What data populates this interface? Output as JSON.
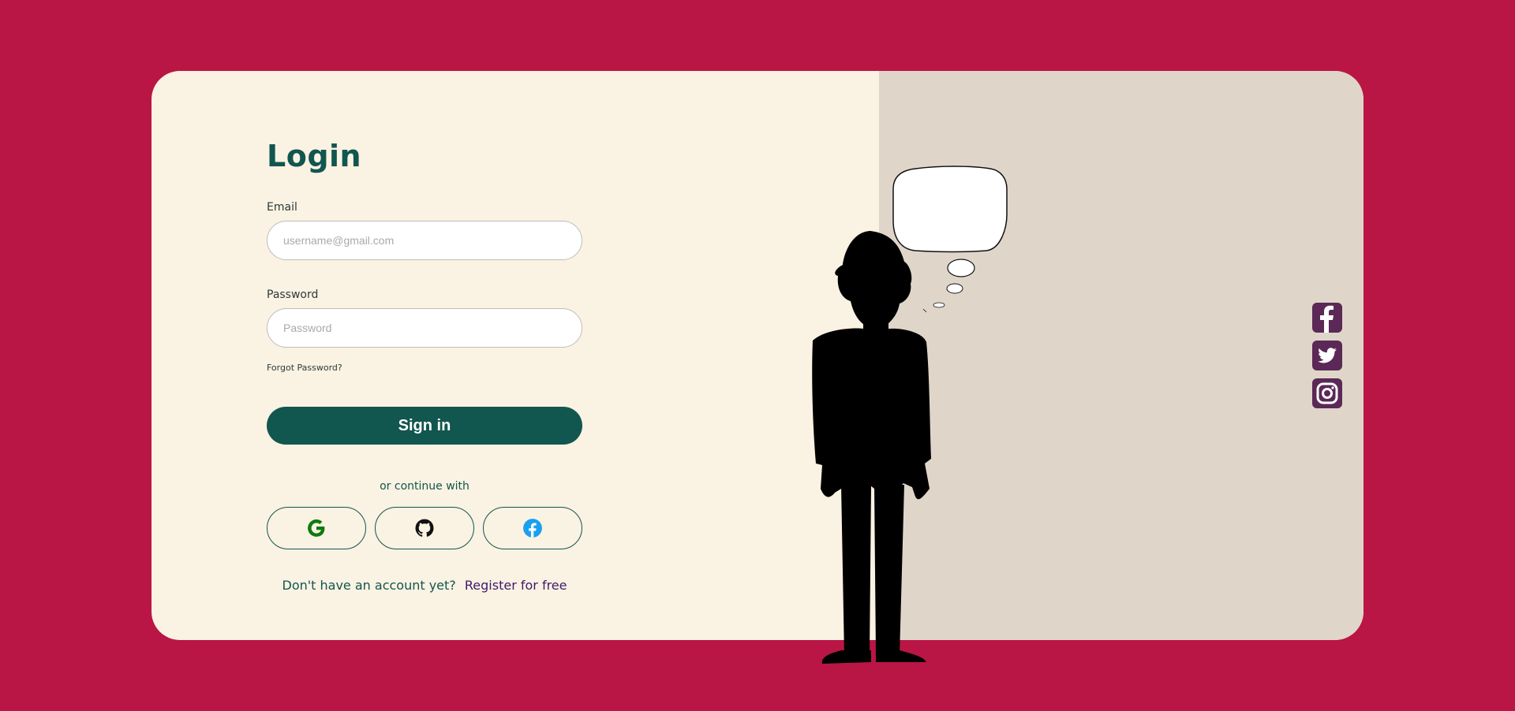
{
  "login": {
    "title": "Login",
    "email_label": "Email",
    "email_placeholder": "username@gmail.com",
    "email_value": "",
    "password_label": "Password",
    "password_placeholder": "Password",
    "password_value": "",
    "forgot_label": "Forgot Password?",
    "signin_label": "Sign in",
    "continue_label": "or continue with",
    "social_buttons": [
      "google-icon",
      "github-icon",
      "facebook-icon"
    ],
    "register_prompt": "Don't have an account yet?",
    "register_link": "Register for free"
  },
  "side_social": [
    "facebook-icon",
    "twitter-icon",
    "instagram-icon"
  ],
  "colors": {
    "background": "#b91645",
    "card_left": "#faf2e2",
    "card_right": "#dfd6c9",
    "primary": "#11564f",
    "link": "#3f1b6b",
    "social_side": "#5b2857",
    "google": "#0f7a0f",
    "facebook": "#1aa0f0"
  }
}
